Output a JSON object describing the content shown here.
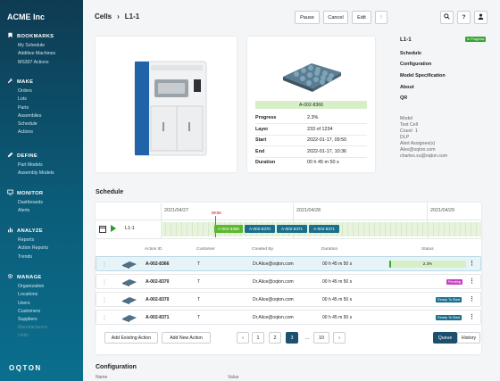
{
  "sidebar": {
    "brand": "ACME Inc",
    "sections": [
      {
        "title": "BOOKMARKS",
        "items": [
          "My Schedule",
          "Additive Machines",
          "MS307 Actions"
        ]
      },
      {
        "title": "MAKE",
        "items": [
          "Orders",
          "Lots",
          "Parts",
          "Assemblies",
          "Schedule",
          "Actions"
        ]
      },
      {
        "title": "DEFINE",
        "items": [
          "Part Models",
          "Assembly Models"
        ]
      },
      {
        "title": "MONITOR",
        "items": [
          "Dashboards",
          "Alerts"
        ]
      },
      {
        "title": "ANALYZE",
        "items": [
          "Reports",
          "Action Reports",
          "Trends"
        ]
      },
      {
        "title": "MANAGE",
        "items": [
          "Organization",
          "Locations",
          "Users",
          "Customers",
          "Suppliers",
          "Manufacturers",
          "Units"
        ]
      }
    ],
    "logo": "OQTON"
  },
  "header": {
    "crumb_root": "Cells",
    "crumb_sep": "›",
    "crumb_current": "L1-1",
    "pause": "Pause",
    "cancel": "Cancel",
    "edit": "Edit",
    "more": "⋮",
    "search_icon": "search-icon",
    "help": "?",
    "user_icon": "user-icon"
  },
  "part": {
    "label": "A-002-8366",
    "rows": [
      {
        "key": "Progress",
        "value": "2.3%"
      },
      {
        "key": "Layer",
        "value": "233 of 1234"
      },
      {
        "key": "Start",
        "value": "2022-01-17, 09:50"
      },
      {
        "key": "End",
        "value": "2022-01-17, 10:36"
      },
      {
        "key": "Duration",
        "value": "00 h 45 m 50 s"
      }
    ]
  },
  "detail": {
    "title": "L1-1",
    "status": "In Progress",
    "status_color": "#3aa33a",
    "links": [
      "Schedule",
      "Configuration",
      "Model Specification",
      "About",
      "QR"
    ],
    "meta": [
      "Model",
      "Test Cell",
      "Count",
      "1",
      "DLP",
      "Alert Assignee(s)",
      "Alex@oqton.com",
      "charles.xu@oqton.com"
    ]
  },
  "schedule": {
    "title": "Schedule",
    "dates": [
      "2021/04/27",
      "2021/04/28",
      "2021/04/29"
    ],
    "now_label": "09:50",
    "cell_name": "L1-1",
    "timeline_chips": [
      {
        "label": "A-002-8366",
        "color": "#5cb82e"
      },
      {
        "label": "A-002-8370",
        "color": "#1a6f8c"
      },
      {
        "label": "A-002-8371",
        "color": "#1a6f8c"
      },
      {
        "label": "A-002-8371",
        "color": "#1a6f8c"
      }
    ],
    "columns": [
      "Action ID",
      "Customer",
      "Created By",
      "Duration",
      "Status"
    ],
    "rows": [
      {
        "id": "A-002-8366",
        "customer": "T",
        "created_by": "Dr.Alice@oqton.com",
        "duration": "00 h 45 m 50 s",
        "status": "2.3%",
        "progress": 0.023
      },
      {
        "id": "A-002-8370",
        "customer": "T",
        "created_by": "Dr.Alice@oqton.com",
        "duration": "00 h 45 m 50 s",
        "status": "Pending",
        "status_color": "#c93ec4"
      },
      {
        "id": "A-002-8370",
        "customer": "T",
        "created_by": "Dr.Alice@oqton.com",
        "duration": "00 h 45 m 50 s",
        "status": "Ready To Start",
        "status_color": "#1a6f8c"
      },
      {
        "id": "A-002-8371",
        "customer": "T",
        "created_by": "Dr.Alice@oqton.com",
        "duration": "00 h 45 m 50 s",
        "status": "Ready To Start",
        "status_color": "#1a6f8c"
      }
    ],
    "add_existing": "Add Existing Action",
    "add_new": "Add New Action",
    "pages": [
      "1",
      "2",
      "3",
      "...",
      "10"
    ],
    "active_page": "3",
    "prev": "‹",
    "next": "›",
    "queue": "Queue",
    "history": "History"
  },
  "configuration": {
    "title": "Configuration",
    "col_name": "Name",
    "col_value": "Value"
  }
}
